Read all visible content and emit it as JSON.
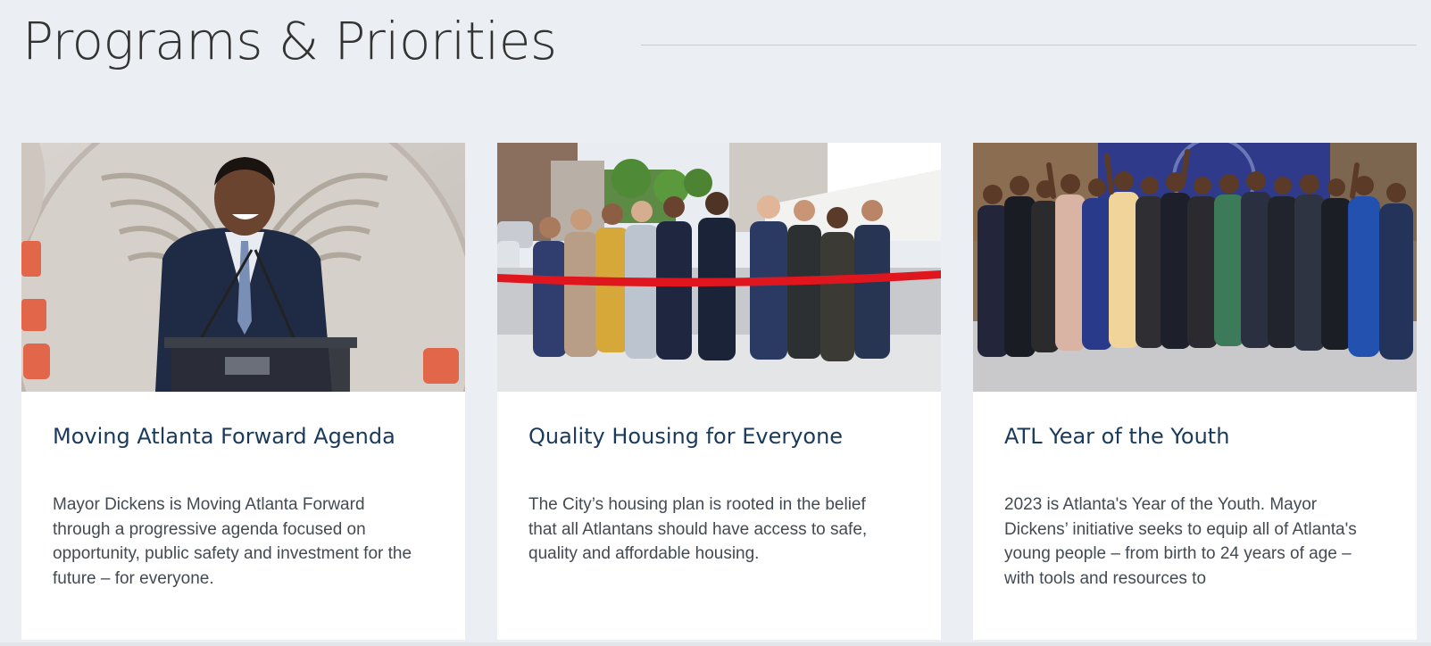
{
  "section": {
    "title": "Programs & Priorities"
  },
  "cards": [
    {
      "title": "Moving Atlanta Forward Agenda",
      "description": "Mayor Dickens is Moving Atlanta Forward through a progressive agenda focused on opportunity, public safety and investment for the future – for everyone.",
      "image": "photo-mayor-at-podium"
    },
    {
      "title": "Quality Housing for Everyone",
      "description": "The City’s housing plan is rooted in the belief that all Atlantans should have access to safe, quality and affordable housing.",
      "image": "photo-ribbon-cutting"
    },
    {
      "title": "ATL Year of the Youth",
      "description": "2023 is Atlanta's Year of the Youth. Mayor Dickens’ initiative seeks to equip all of Atlanta's young people – from birth to 24 years of age – with tools and resources to",
      "image": "photo-youth-group"
    }
  ],
  "colors": {
    "background": "#ebeef2",
    "card": "#ffffff",
    "title_text": "#1a3a5c",
    "body_text": "#444a52",
    "heading_text": "#333333",
    "ribbon": "#e0161f"
  }
}
